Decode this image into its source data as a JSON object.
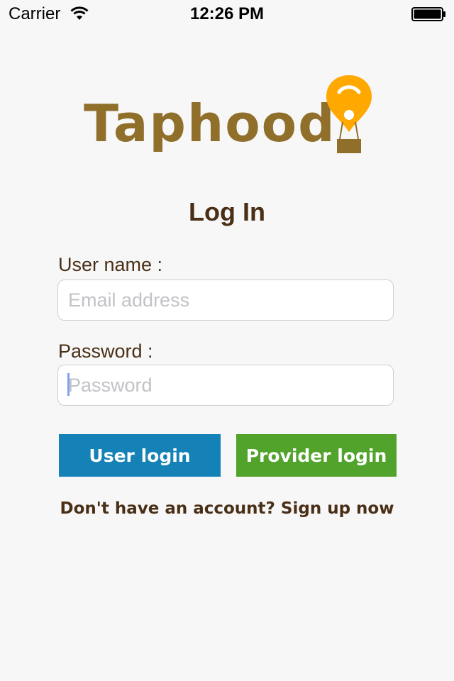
{
  "status_bar": {
    "carrier": "Carrier",
    "time": "12:26 PM"
  },
  "logo": {
    "text": "Taphood",
    "icon": "hot-air-balloon-icon",
    "text_color": "#8f6f2a",
    "balloon_color": "#ffa800"
  },
  "login": {
    "title": "Log In",
    "username_label": "User name :",
    "username_placeholder": "Email address",
    "password_label": "Password :",
    "password_placeholder": "Password",
    "user_login_button": "User login",
    "provider_login_button": "Provider login",
    "signup_text": "Don't have an account? Sign up now"
  },
  "colors": {
    "background": "#f7f7f7",
    "text_brown": "#4a2f17",
    "user_button": "#1482b6",
    "provider_button": "#52a32b"
  }
}
